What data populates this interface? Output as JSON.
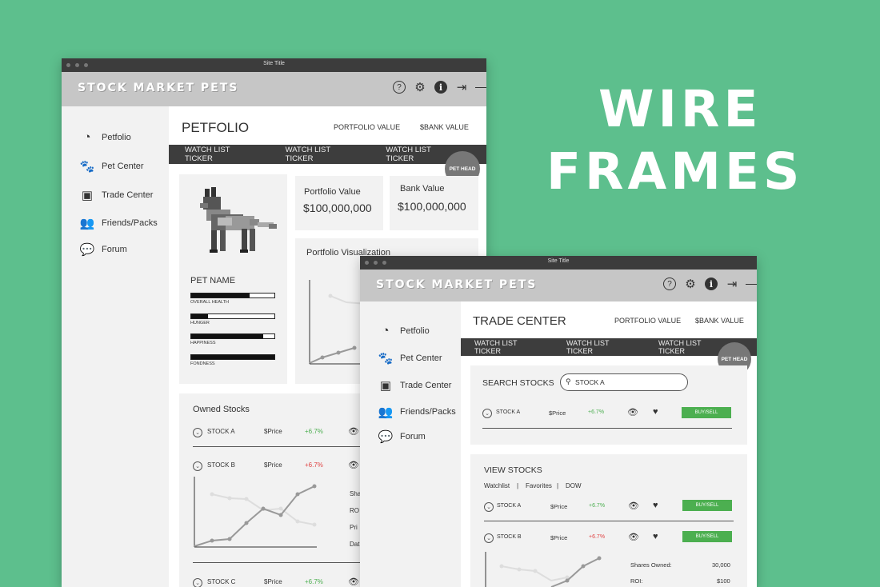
{
  "heading": {
    "line1": "WIRE",
    "line2": "FRAMES"
  },
  "colors": {
    "background": "#5dbf8d",
    "accent_green": "#4caf50",
    "negative_red": "#e04545"
  },
  "icons": {
    "help": "question-circle-icon",
    "settings": "gear-icon",
    "info": "info-circle-icon",
    "logout": "logout-icon"
  },
  "win1": {
    "title": "Site Title",
    "brand": "STOCK MARKET PETS",
    "nav": [
      "Petfolio",
      "Pet Center",
      "Trade Center",
      "Friends/Packs",
      "Forum"
    ],
    "page_title": "PETFOLIO",
    "links": [
      "PORTFOLIO VALUE",
      "$BANK VALUE"
    ],
    "tickers": [
      "WATCH LIST  TICKER",
      "WATCH LIST TICKER",
      "WATCH LIST TICKER"
    ],
    "pet_head": "PET HEAD",
    "pet_name": "PET NAME",
    "stats": [
      {
        "label": "OVERALL HEALTH",
        "value": 0.7
      },
      {
        "label": "HUNGER",
        "value": 0.2
      },
      {
        "label": "HAPPINESS",
        "value": 0.87
      },
      {
        "label": "FONDNESS",
        "value": 1.0
      }
    ],
    "portfolio": {
      "label": "Portfolio Value",
      "value": "$100,000,000"
    },
    "bank": {
      "label": "Bank Value",
      "value": "$100,000,000"
    },
    "viz_title": "Portfolio Visualization",
    "owned_title": "Owned Stocks",
    "owned": [
      {
        "name": "STOCK A",
        "price": "$Price",
        "change": "+6.7%",
        "dir": "up"
      },
      {
        "name": "STOCK B",
        "price": "$Price",
        "change": "+6.7%",
        "dir": "down"
      },
      {
        "name": "STOCK C",
        "price": "$Price",
        "change": "+6.7%",
        "dir": "up"
      }
    ],
    "detail_labels": [
      "Sha",
      "RO",
      "Pri",
      "Dat"
    ]
  },
  "win2": {
    "title": "Site Title",
    "brand": "STOCK MARKET PETS",
    "nav": [
      "Petfolio",
      "Pet Center",
      "Trade Center",
      "Friends/Packs",
      "Forum"
    ],
    "page_title": "TRADE CENTER",
    "links": [
      "PORTFOLIO VALUE",
      "$BANK VALUE"
    ],
    "tickers": [
      "WATCH LIST  TICKER",
      "WATCH LIST TICKER",
      "WATCH LIST TICKER"
    ],
    "pet_head": "PET HEAD",
    "search_label": "SEARCH STOCKS",
    "search_value": "STOCK A",
    "search_result": {
      "name": "STOCK A",
      "price": "$Price",
      "change": "+6.7%",
      "button": "BUY/SELL"
    },
    "view_title": "VIEW STOCKS",
    "filters": [
      "Watchlist",
      "Favorites",
      "DOW"
    ],
    "filter_sep": "|",
    "view_rows": [
      {
        "name": "STOCK A",
        "price": "$Price",
        "change": "+6.7%",
        "dir": "up",
        "button": "BUY/SELL"
      },
      {
        "name": "STOCK B",
        "price": "$Price",
        "change": "+6.7%",
        "dir": "down",
        "button": "BUY/SELL"
      }
    ],
    "details": [
      {
        "label": "Shares Owned:",
        "value": "30,000"
      },
      {
        "label": "ROI:",
        "value": "$100"
      }
    ]
  }
}
